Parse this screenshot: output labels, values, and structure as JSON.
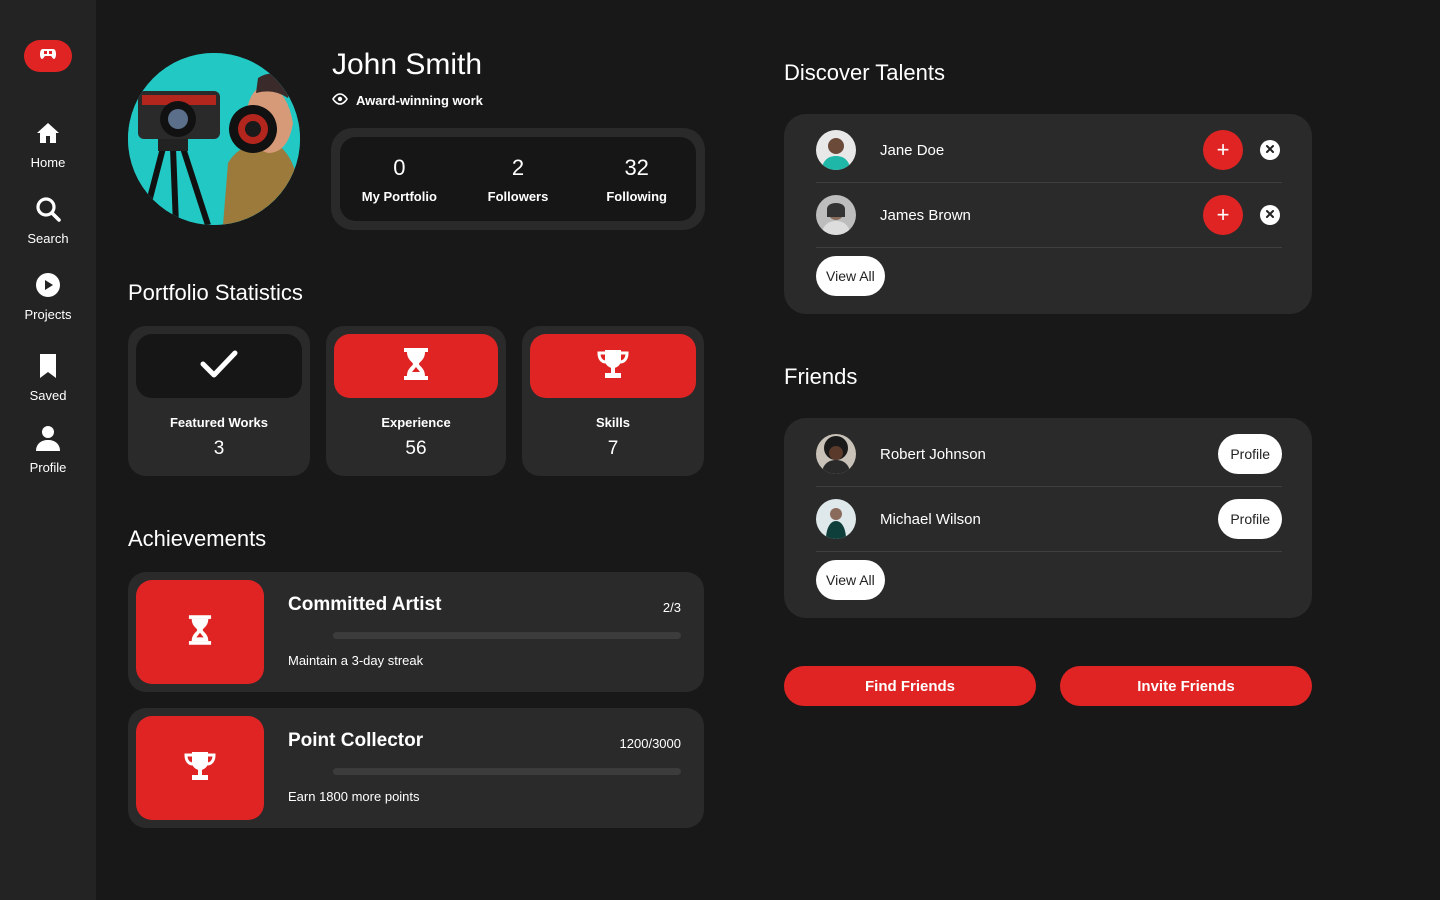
{
  "colors": {
    "accent": "#e02424",
    "background": "#181818",
    "sidebar": "#232323",
    "card": "#2a2a2a"
  },
  "sidebar": {
    "logo_icon": "game-controller-icon",
    "items": [
      {
        "label": "Home",
        "icon": "home-icon"
      },
      {
        "label": "Search",
        "icon": "search-icon"
      },
      {
        "label": "Projects",
        "icon": "play-icon"
      },
      {
        "label": "Saved",
        "icon": "bookmark-icon"
      },
      {
        "label": "Profile",
        "icon": "person-icon"
      }
    ]
  },
  "profile": {
    "name": "John Smith",
    "tagline": "Award-winning work",
    "stats": [
      {
        "value": "0",
        "label": "My Portfolio"
      },
      {
        "value": "2",
        "label": "Followers"
      },
      {
        "value": "32",
        "label": "Following"
      }
    ]
  },
  "portfolio_statistics": {
    "title": "Portfolio Statistics",
    "cards": [
      {
        "label": "Featured Works",
        "value": "3",
        "icon": "checkmark-icon"
      },
      {
        "label": "Experience",
        "value": "56",
        "icon": "hourglass-icon"
      },
      {
        "label": "Skills",
        "value": "7",
        "icon": "trophy-icon"
      }
    ]
  },
  "achievements": {
    "title": "Achievements",
    "items": [
      {
        "title": "Committed Artist",
        "count": "2/3",
        "progress": 0,
        "description": "Maintain a 3-day streak",
        "icon": "hourglass-icon"
      },
      {
        "title": "Point Collector",
        "count": "1200/3000",
        "progress": 0,
        "description": "Earn 1800 more points",
        "icon": "trophy-icon"
      }
    ]
  },
  "discover": {
    "title": "Discover Talents",
    "people": [
      {
        "name": "Jane Doe",
        "add_label": "+"
      },
      {
        "name": "James Brown",
        "add_label": "+"
      }
    ],
    "view_all_label": "View All"
  },
  "friends": {
    "title": "Friends",
    "people": [
      {
        "name": "Robert Johnson",
        "button_label": "Profile"
      },
      {
        "name": "Michael Wilson",
        "button_label": "Profile"
      }
    ],
    "view_all_label": "View All"
  },
  "actions": {
    "find_friends": "Find Friends",
    "invite_friends": "Invite Friends"
  }
}
